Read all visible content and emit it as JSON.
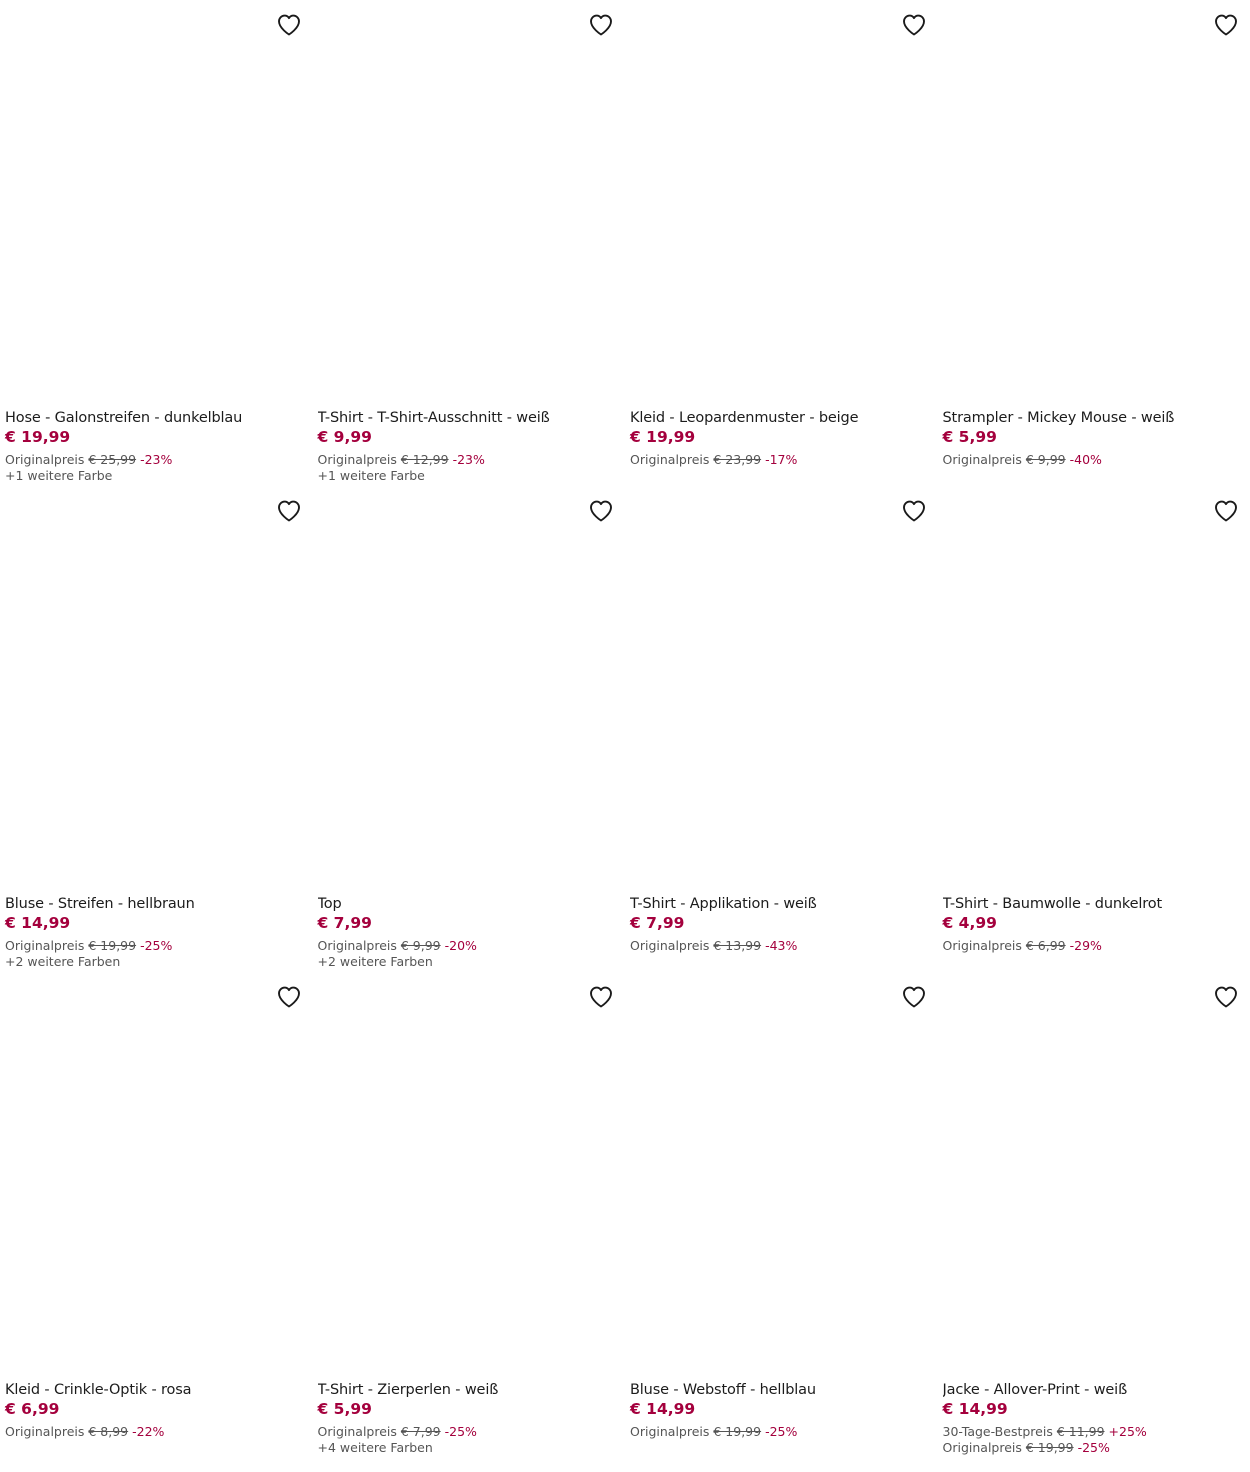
{
  "colors": {
    "price": "#a4003d",
    "discount": "#a4003d",
    "text": "#1c1c1c",
    "muted": "#555555"
  },
  "wishlist_icon": "heart-outline-icon",
  "products": [
    {
      "title": "Hose - Galonstreifen - dunkelblau",
      "price": "€ 19,99",
      "refs": [
        {
          "label": "Originalpreis",
          "old": "€ 25,99",
          "disc": "-23%"
        }
      ],
      "colors": "+1 weitere Farbe"
    },
    {
      "title": "T-Shirt - T-Shirt-Ausschnitt - weiß",
      "price": "€ 9,99",
      "refs": [
        {
          "label": "Originalpreis",
          "old": "€ 12,99",
          "disc": "-23%"
        }
      ],
      "colors": "+1 weitere Farbe"
    },
    {
      "title": "Kleid - Leopardenmuster - beige",
      "price": "€ 19,99",
      "refs": [
        {
          "label": "Originalpreis",
          "old": "€ 23,99",
          "disc": "-17%"
        }
      ],
      "colors": ""
    },
    {
      "title": "Strampler - Mickey Mouse - weiß",
      "price": "€ 5,99",
      "refs": [
        {
          "label": "Originalpreis",
          "old": "€ 9,99",
          "disc": "-40%"
        }
      ],
      "colors": ""
    },
    {
      "title": "Bluse - Streifen - hellbraun",
      "price": "€ 14,99",
      "refs": [
        {
          "label": "Originalpreis",
          "old": "€ 19,99",
          "disc": "-25%"
        }
      ],
      "colors": "+2 weitere Farben"
    },
    {
      "title": "Top",
      "price": "€ 7,99",
      "refs": [
        {
          "label": "Originalpreis",
          "old": "€ 9,99",
          "disc": "-20%"
        }
      ],
      "colors": "+2 weitere Farben"
    },
    {
      "title": "T-Shirt - Applikation - weiß",
      "price": "€ 7,99",
      "refs": [
        {
          "label": "Originalpreis",
          "old": "€ 13,99",
          "disc": "-43%"
        }
      ],
      "colors": ""
    },
    {
      "title": "T-Shirt - Baumwolle - dunkelrot",
      "price": "€ 4,99",
      "refs": [
        {
          "label": "Originalpreis",
          "old": "€ 6,99",
          "disc": "-29%"
        }
      ],
      "colors": ""
    },
    {
      "title": "Kleid - Crinkle-Optik - rosa",
      "price": "€ 6,99",
      "refs": [
        {
          "label": "Originalpreis",
          "old": "€ 8,99",
          "disc": "-22%"
        }
      ],
      "colors": ""
    },
    {
      "title": "T-Shirt - Zierperlen - weiß",
      "price": "€ 5,99",
      "refs": [
        {
          "label": "Originalpreis",
          "old": "€ 7,99",
          "disc": "-25%"
        }
      ],
      "colors": "+4 weitere Farben"
    },
    {
      "title": "Bluse - Webstoff - hellblau",
      "price": "€ 14,99",
      "refs": [
        {
          "label": "Originalpreis",
          "old": "€ 19,99",
          "disc": "-25%"
        }
      ],
      "colors": ""
    },
    {
      "title": "Jacke - Allover-Print - weiß",
      "price": "€ 14,99",
      "refs": [
        {
          "label": "30-Tage-Bestpreis",
          "old": "€ 11,99",
          "disc": "+25%"
        },
        {
          "label": "Originalpreis",
          "old": "€ 19,99",
          "disc": "-25%"
        }
      ],
      "colors": ""
    }
  ]
}
